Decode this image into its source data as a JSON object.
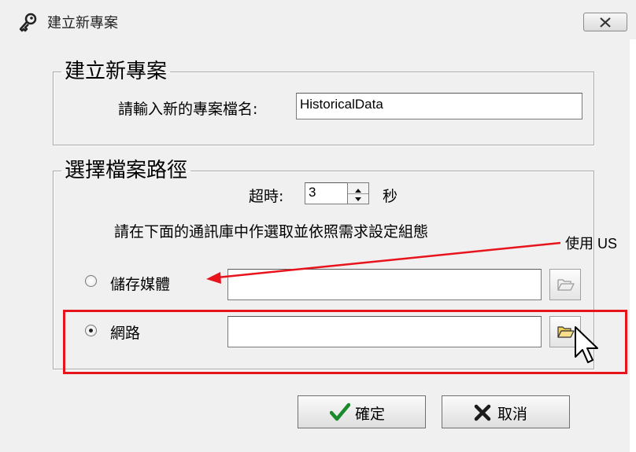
{
  "window": {
    "title": "建立新專案",
    "icon": "key-icon"
  },
  "group_project": {
    "legend": "建立新專案",
    "name_label": "請輸入新的專案檔名:",
    "name_value": "HistoricalData"
  },
  "group_path": {
    "legend": "選擇檔案路徑",
    "timeout_label": "超時:",
    "timeout_value": "3",
    "timeout_unit": "秒",
    "instruction": "請在下面的通訊庫中作選取並依照需求設定組態",
    "options": [
      {
        "label": "儲存媒體",
        "selected": false,
        "path": ""
      },
      {
        "label": "網路",
        "selected": true,
        "path": ""
      }
    ]
  },
  "buttons": {
    "ok": "確定",
    "cancel": "取消"
  },
  "annotation": {
    "text": "使用 US",
    "color": "#e8141c"
  }
}
